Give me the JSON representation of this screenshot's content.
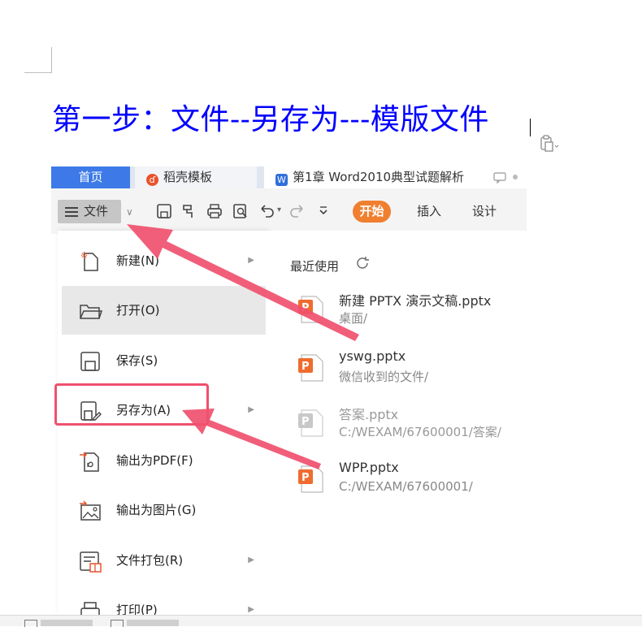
{
  "heading": "第一步：文件--另存为---模版文件",
  "tabs": [
    {
      "label": "首页",
      "icon": "home-tab"
    },
    {
      "label": "稻壳模板",
      "icon": "daoke-logo-icon"
    },
    {
      "label": "第1章 Word2010典型试题解析",
      "icon": "word-doc-icon"
    }
  ],
  "toolbar": {
    "file_label": "文件",
    "start_label": "开始",
    "insert_label": "插入",
    "design_label": "设计",
    "icons": [
      "save-icon",
      "format-painter-icon",
      "print-icon",
      "print-preview-icon",
      "undo-icon",
      "redo-icon",
      "more-icon"
    ]
  },
  "file_menu": {
    "items": [
      {
        "label": "新建(N)",
        "icon": "new-file-icon",
        "has_submenu": true
      },
      {
        "label": "打开(O)",
        "icon": "open-folder-icon",
        "has_submenu": false
      },
      {
        "label": "保存(S)",
        "icon": "save-icon",
        "has_submenu": false
      },
      {
        "label": "另存为(A)",
        "icon": "save-as-icon",
        "has_submenu": true
      },
      {
        "label": "输出为PDF(F)",
        "icon": "export-pdf-icon",
        "has_submenu": false
      },
      {
        "label": "输出为图片(G)",
        "icon": "export-image-icon",
        "has_submenu": false
      },
      {
        "label": "文件打包(R)",
        "icon": "package-icon",
        "has_submenu": true
      },
      {
        "label": "打印(P)",
        "icon": "print-icon",
        "has_submenu": true
      }
    ]
  },
  "recent": {
    "title": "最近使用",
    "files": [
      {
        "name": "新建 PPTX 演示文稿.pptx",
        "path": "桌面/"
      },
      {
        "name": "yswg.pptx",
        "path": "微信收到的文件/"
      },
      {
        "name": "答案.pptx",
        "path": "C:/WEXAM/67600001/答案/"
      },
      {
        "name": "WPP.pptx",
        "path": "C:/WEXAM/67600001/"
      }
    ]
  },
  "colors": {
    "heading": "#0000ff",
    "accent_tab": "#3d7ae8",
    "start_button": "#f07f30",
    "annotation": "#f0506e",
    "ppt_icon": "#ef6c2f"
  }
}
